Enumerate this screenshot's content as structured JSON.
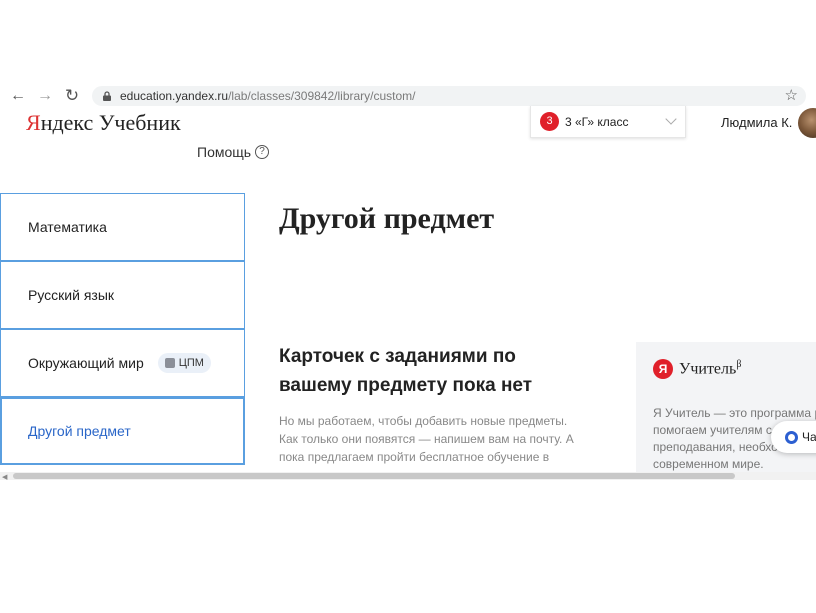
{
  "browser": {
    "back_icon": "←",
    "forward_icon": "→",
    "reload_icon": "↻",
    "url_host": "education.yandex.ru",
    "url_path": "/lab/classes/309842/library/custom/",
    "star_icon": "☆"
  },
  "header": {
    "logo_y": "Я",
    "logo_rest": "ндекс Учебник",
    "help_label": "Помощь",
    "help_icon": "?",
    "class_badge": "3",
    "class_label": "3 «Г» класс",
    "user_name": "Людмила К."
  },
  "subjects": [
    {
      "label": "Математика"
    },
    {
      "label": "Русский язык"
    },
    {
      "label": "Окружающий мир",
      "badge": "ЦПМ"
    },
    {
      "label": "Другой предмет"
    }
  ],
  "main": {
    "title": "Другой предмет",
    "empty_heading": "Карточек с заданиями по вашему предмету пока нет",
    "empty_text": "Но мы работаем, чтобы добавить новые предметы. Как только они появятся — напишем вам на почту. А пока предлагаем пройти бесплатное обучение в"
  },
  "promo": {
    "ya": "Я",
    "title": "Учитель",
    "title_sup": "β",
    "text": "Я Учитель — это программа р помогаем учителям с преподавания, необхо современном мире."
  },
  "chat": {
    "label": "Ча"
  },
  "colors": {
    "accent_blue": "#2a66c8",
    "border_blue": "#5a9fe0",
    "brand_red": "#e0202a"
  }
}
